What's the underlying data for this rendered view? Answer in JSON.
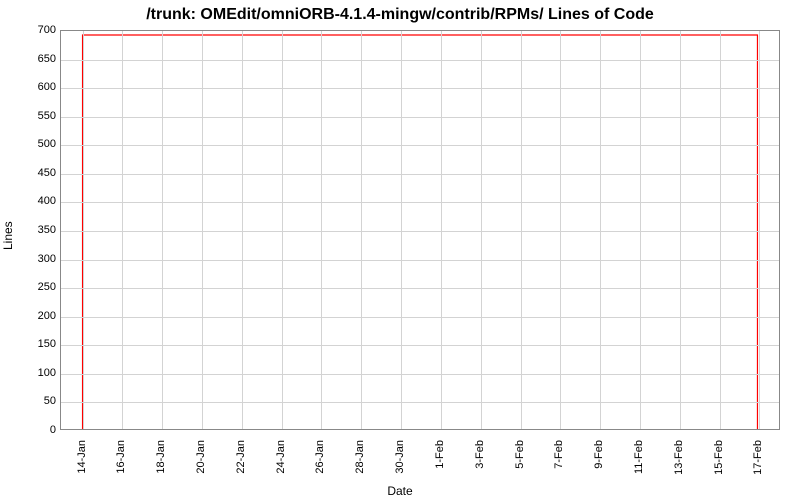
{
  "chart_data": {
    "type": "line",
    "title": "/trunk: OMEdit/omniORB-4.1.4-mingw/contrib/RPMs/ Lines of Code",
    "xlabel": "Date",
    "ylabel": "Lines",
    "ylim": [
      0,
      700
    ],
    "yticks": [
      0,
      50,
      100,
      150,
      200,
      250,
      300,
      350,
      400,
      450,
      500,
      550,
      600,
      650,
      700
    ],
    "x_categories": [
      "14-Jan",
      "16-Jan",
      "18-Jan",
      "20-Jan",
      "22-Jan",
      "24-Jan",
      "26-Jan",
      "28-Jan",
      "30-Jan",
      "1-Feb",
      "3-Feb",
      "5-Feb",
      "7-Feb",
      "9-Feb",
      "11-Feb",
      "13-Feb",
      "15-Feb",
      "17-Feb"
    ],
    "series": [
      {
        "name": "Lines of Code",
        "color": "#ff0000",
        "points": [
          {
            "x": "14-Jan",
            "y": 0
          },
          {
            "x": "14-Jan",
            "y": 693
          },
          {
            "x": "17-Feb",
            "y": 693
          },
          {
            "x": "17-Feb",
            "y": 0
          }
        ]
      }
    ]
  }
}
